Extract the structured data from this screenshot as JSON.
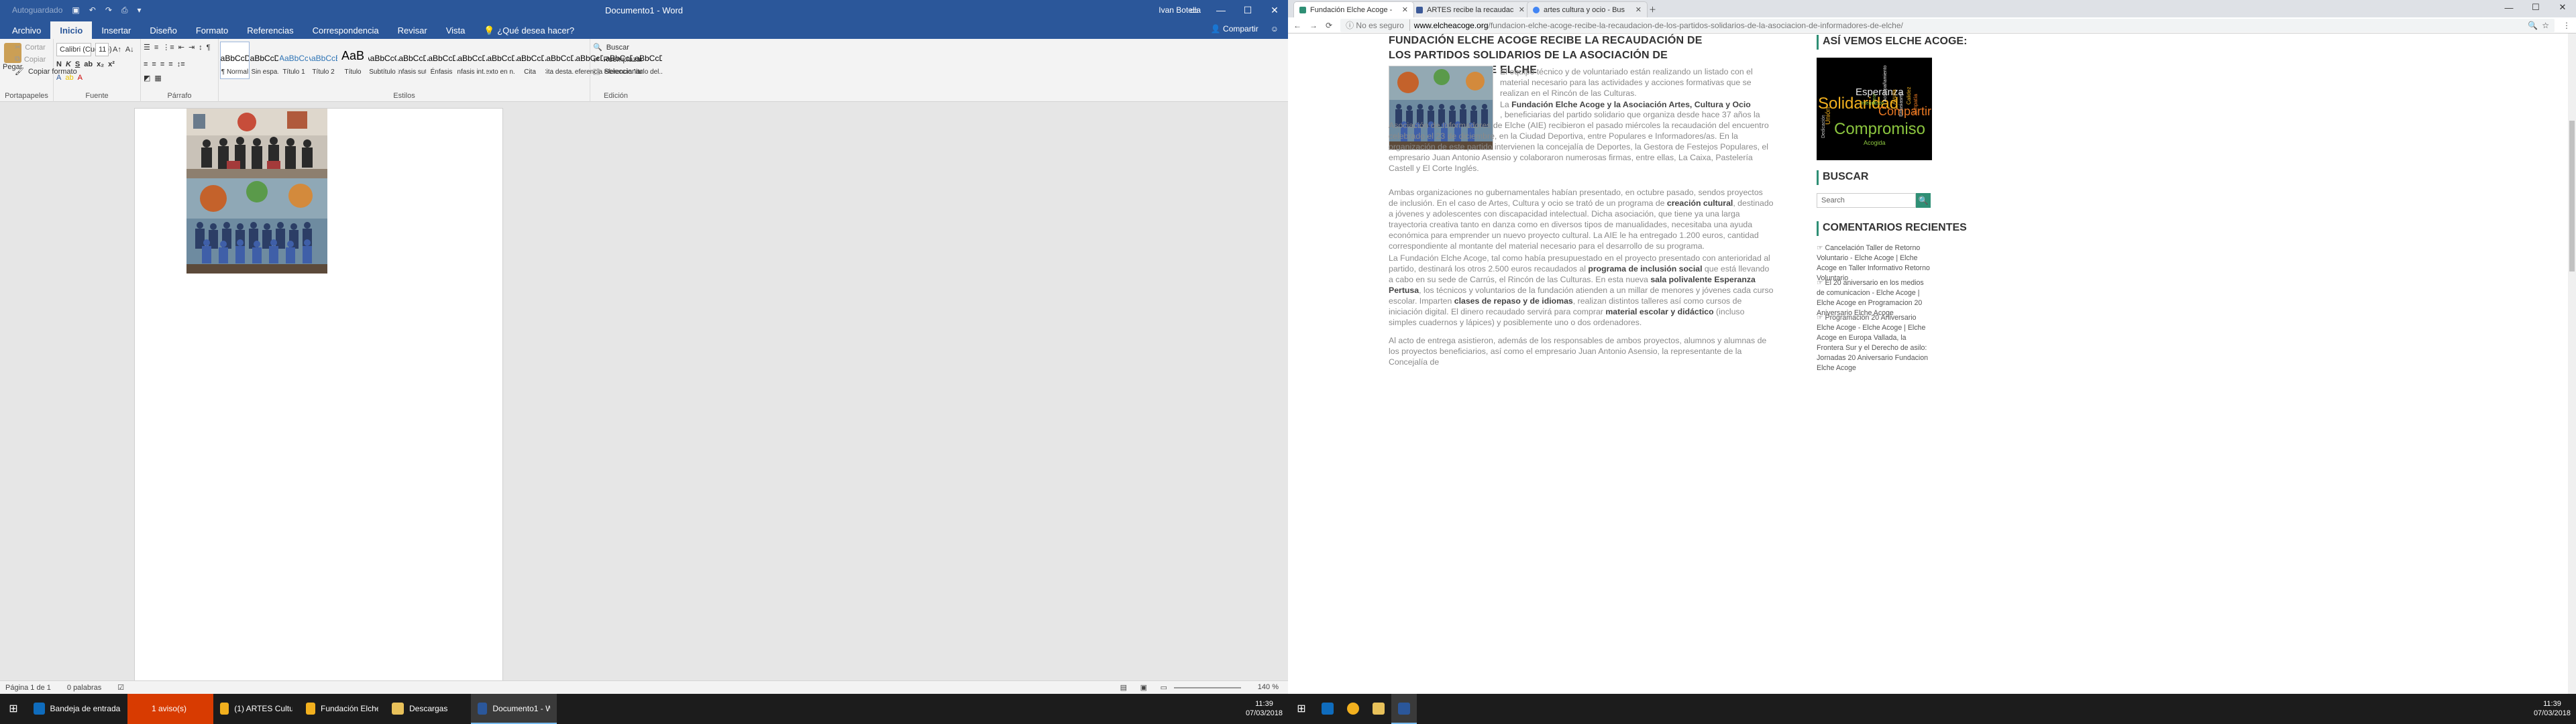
{
  "word": {
    "qat_text": "Autoguardado",
    "doc_title": "Documento1 - Word",
    "user": "Ivan Botella",
    "tabs": [
      "Archivo",
      "Inicio",
      "Insertar",
      "Diseño",
      "Formato",
      "Referencias",
      "Correspondencia",
      "Revisar",
      "Vista"
    ],
    "tell_me": "¿Qué desea hacer?",
    "share": "Compartir",
    "clipboard": {
      "paste": "Pegar",
      "cut": "Cortar",
      "copy": "Copiar",
      "format": "Copiar formato",
      "label": "Portapapeles"
    },
    "font": {
      "name": "Calibri (Cuerpo)",
      "size": "11",
      "label": "Fuente"
    },
    "paragraph_label": "Párrafo",
    "styles_label": "Estilos",
    "styles": [
      {
        "preview": "AaBbCcDc",
        "name": "¶ Normal"
      },
      {
        "preview": "AaBbCcDc",
        "name": "¶ Sin espa..."
      },
      {
        "preview": "AaBbCc",
        "name": "Título 1"
      },
      {
        "preview": "AaBbCcE",
        "name": "Título 2"
      },
      {
        "preview": "AaB",
        "name": "Título"
      },
      {
        "preview": "AaBbCcC",
        "name": "Subtítulo"
      },
      {
        "preview": "AaBbCcDi",
        "name": "Énfasis sutil"
      },
      {
        "preview": "AaBbCcDi",
        "name": "Énfasis"
      },
      {
        "preview": "AaBbCcDi",
        "name": "Énfasis int..."
      },
      {
        "preview": "AaBbCcDi",
        "name": "Texto en n..."
      },
      {
        "preview": "AaBbCcDi",
        "name": "Cita"
      },
      {
        "preview": "AaBbCcDi",
        "name": "Cita desta..."
      },
      {
        "preview": "AaBbCcDi",
        "name": "Referencia..."
      },
      {
        "preview": "AaBbCcDi",
        "name": "Referencia..."
      },
      {
        "preview": "AaBbCcDi",
        "name": "Título del..."
      }
    ],
    "editing": {
      "find": "Buscar",
      "replace": "Reemplazar",
      "select": "Seleccionar",
      "label": "Edición"
    },
    "status": {
      "page": "Página 1 de 1",
      "words": "0 palabras",
      "zoom": "140 %"
    }
  },
  "chrome": {
    "tabs": [
      {
        "title": "Fundación Elche Acoge -",
        "active": true
      },
      {
        "title": "ARTES recibe la recaudac",
        "active": false
      },
      {
        "title": "artes cultura y ocio - Bus",
        "active": false
      }
    ],
    "security": "No es seguro",
    "url_host": "www.elcheacoge.org",
    "url_path": "/fundacion-elche-acoge-recibe-la-recaudacion-de-los-partidos-solidarios-de-la-asociacion-de-informadores-de-elche/"
  },
  "article": {
    "title": "FUNDACIÓN ELCHE ACOGE RECIBE LA RECAUDACIÓN DE LOS PARTIDOS SOLIDARIOS DE LA ASOCIACIÓN DE INFORMADORES DE ELCHE",
    "p1": "El equipo técnico y de voluntariado están realizando un listado con el material necesario para las actividades y acciones formativas que se realizan en el Rincón de las Culturas.",
    "p2a": "La ",
    "p2b": "Fundación Elche Acoge y la Asociación Artes, Cultura y Ocio",
    "p2c": ", beneficiarias del partido solidario que organiza desde hace 37 años la Asociación de Informadores de Elche (AIE) recibieron el pasado miércoles la recaudación del encuentro celebrado el 23 de diciembre, en la Ciudad Deportiva, entre Populares e Informadores/as. En la organización de este partido intervienen la concejalía de Deportes, la Gestora de Festejos Populares, el empresario Juan Antonio Asensio y colaboraron numerosas firmas, entre ellas, La Caixa, Pastelería Castell y El Corte Inglés.",
    "p3a": "Ambas organizaciones no gubernamentales habían presentado, en octubre pasado, sendos proyectos de inclusión. En el caso de Artes, Cultura y ocio se trató de un programa de ",
    "p3b": "creación cultural",
    "p3c": ", destinado a jóvenes y adolescentes con discapacidad intelectual. Dicha asociación, que tiene ya una larga trayectoria creativa tanto en danza como en diversos tipos de manualidades, necesitaba una ayuda económica para emprender un nuevo proyecto cultural. La AIE le ha entregado 1.200 euros, cantidad correspondiente al montante del material necesario para el desarrollo de su programa.",
    "p4a": "La Fundación Elche Acoge, tal como había presupuestado en el proyecto presentado con anterioridad al partido, destinará los otros 2.500 euros recaudados al ",
    "p4b": "programa de inclusión social",
    "p4c": " que está llevando a cabo en su sede de Carrús, el Rincón de las Culturas. En esta nueva ",
    "p4d": "sala polivalente Esperanza Pertusa",
    "p4e": ", los técnicos y voluntarios de la fundación atienden a un millar de menores y jóvenes cada curso escolar. Imparten ",
    "p4f": "clases de repaso y de idiomas",
    "p4g": ", realizan distintos talleres así como cursos de iniciación digital. El dinero recaudado servirá para comprar ",
    "p4h": "material escolar y didáctico",
    "p4i": " (incluso simples cuadernos y lápices) y posiblemente uno o dos ordenadores.",
    "p5": "Al acto de entrega asistieron, además de los responsables de ambos proyectos, alumnos y alumnas de los proyectos beneficiarios, así como el empresario Juan Antonio Asensio, la representante de la Concejalía de"
  },
  "sidebar": {
    "widget1": "ASÍ VEMOS ELCHE ACOGE:",
    "cloud": [
      "Esperanza",
      "Solidaridad",
      "Compartir",
      "Compromiso",
      "Unión",
      "Empatía",
      "Integración",
      "Dedicación",
      "Acogida",
      "Acompañamiento",
      "Ayuda",
      "Calidez",
      "Entusiasmo",
      "Amor"
    ],
    "widget2": "BUSCAR",
    "search_placeholder": "Search",
    "widget3": "COMENTARIOS RECIENTES",
    "comments": [
      {
        "link": "Cancelación Taller de Retorno Voluntario - Elche Acoge | Elche Acoge",
        "on": "en",
        "post": "Taller Informativo Retorno Voluntario"
      },
      {
        "link": "El 20 aniversario en los medios de comunicacion - Elche Acoge | Elche Acoge",
        "on": "en",
        "post": "Programacion 20 Aniversario Elche Acoge"
      },
      {
        "link": "Programacion 20 Aniversario Elche Acoge - Elche Acoge | Elche Acoge",
        "on": "en",
        "post": "Europa Vallada, la Frontera Sur y el Derecho de asilo: Jornadas 20 Aniversario Fundacion Elche Acoge"
      }
    ]
  },
  "taskbar_left": [
    {
      "label": "Bandeja de entrada...",
      "color": "#0f6cbd"
    },
    {
      "label": "1 aviso(s)",
      "color": "#d83b01"
    },
    {
      "label": "(1) ARTES Cultura y...",
      "color": "#f2b01e"
    },
    {
      "label": "Fundación Elche A...",
      "color": "#f2b01e"
    },
    {
      "label": "Descargas",
      "color": "#e8c15a"
    },
    {
      "label": "Documento1 - Word",
      "color": "#2b579a"
    }
  ],
  "clock_left": {
    "time": "11:39",
    "date": "07/03/2018"
  },
  "clock_right": {
    "time": "11:39",
    "date": "07/03/2018"
  }
}
